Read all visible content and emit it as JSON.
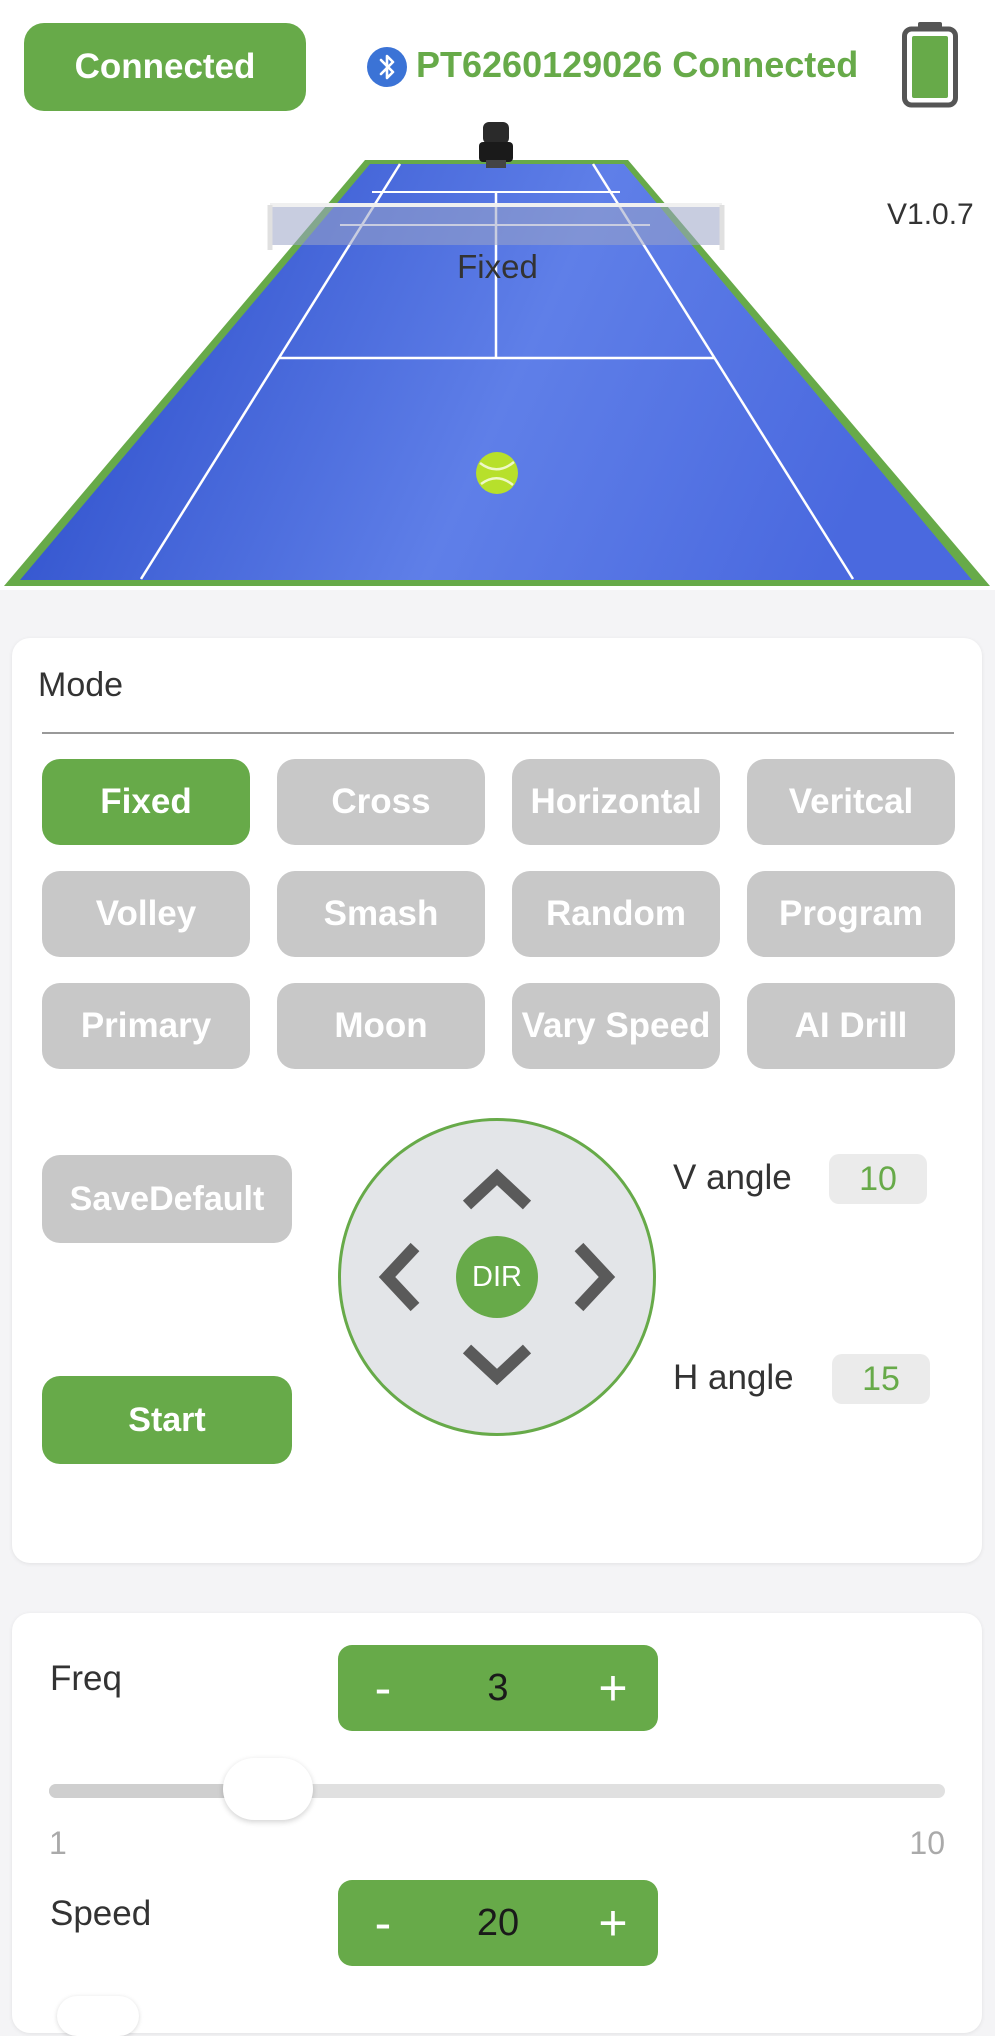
{
  "header": {
    "connect_button": "Connected",
    "device_status": "PT6260129026 Connected",
    "bluetooth_icon": "bluetooth-icon",
    "battery_icon": "battery-full-icon"
  },
  "court": {
    "version": "V1.0.7",
    "mode_label": "Fixed",
    "court_color": "#3d5fd6",
    "line_color": "#67aa49"
  },
  "mode_panel": {
    "title": "Mode",
    "modes": [
      {
        "label": "Fixed",
        "active": true
      },
      {
        "label": "Cross",
        "active": false
      },
      {
        "label": "Horizontal",
        "active": false
      },
      {
        "label": "Veritcal",
        "active": false
      },
      {
        "label": "Volley",
        "active": false
      },
      {
        "label": "Smash",
        "active": false
      },
      {
        "label": "Random",
        "active": false
      },
      {
        "label": "Program",
        "active": false
      },
      {
        "label": "Primary",
        "active": false
      },
      {
        "label": "Moon",
        "active": false
      },
      {
        "label": "Vary Speed",
        "active": false
      },
      {
        "label": "AI Drill",
        "active": false
      }
    ],
    "save_default": "SaveDefault",
    "start": "Start",
    "dpad_center": "DIR",
    "v_angle_label": "V angle",
    "v_angle_value": "10",
    "h_angle_label": "H angle",
    "h_angle_value": "15"
  },
  "settings": {
    "freq_label": "Freq",
    "freq_value": "3",
    "freq_min": "1",
    "freq_max": "10",
    "freq_level": 3,
    "speed_label": "Speed",
    "speed_value": "20",
    "minus": "-",
    "plus": "+"
  },
  "colors": {
    "accent": "#67aa49",
    "inactive": "#c8c8c8"
  }
}
